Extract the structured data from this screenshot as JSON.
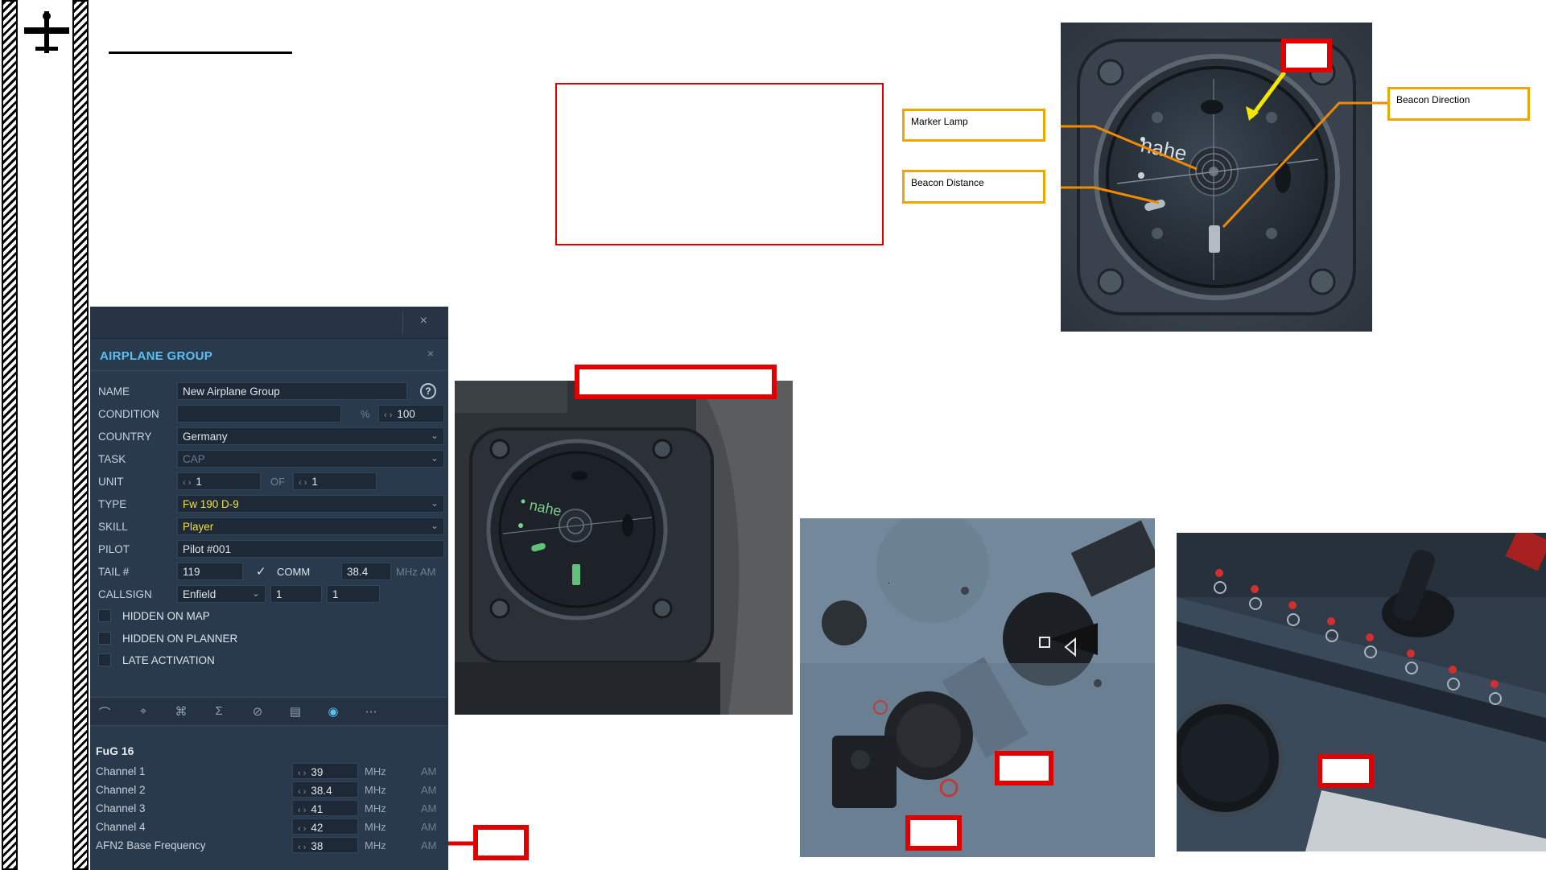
{
  "callouts": {
    "marker_lamp": "Marker Lamp",
    "beacon_distance": "Beacon Distance",
    "beacon_direction": "Beacon Direction"
  },
  "instrument": {
    "dial_text": "nahe"
  },
  "panel": {
    "title": "AIRPLANE GROUP",
    "close_glyph": "×",
    "help_glyph": "?",
    "fields": {
      "name": {
        "label": "NAME",
        "value": "New Airplane Group"
      },
      "condition": {
        "label": "CONDITION",
        "value": "100",
        "unit": "%"
      },
      "country": {
        "label": "COUNTRY",
        "value": "Germany"
      },
      "task": {
        "label": "TASK",
        "value": "CAP"
      },
      "unit": {
        "label": "UNIT",
        "value": "1",
        "of_label": "OF",
        "of_value": "1"
      },
      "type": {
        "label": "TYPE",
        "value": "Fw 190 D-9"
      },
      "skill": {
        "label": "SKILL",
        "value": "Player"
      },
      "pilot": {
        "label": "PILOT",
        "value": "Pilot #001"
      },
      "tail": {
        "label": "TAIL #",
        "value": "119",
        "comm_label": "COMM",
        "comm_value": "38.4",
        "mhz": "MHz",
        "am": "AM"
      },
      "callsign": {
        "label": "CALLSIGN",
        "value": "Enfield",
        "num1": "1",
        "num2": "1"
      }
    },
    "checkboxes": [
      "HIDDEN ON MAP",
      "HIDDEN ON PLANNER",
      "LATE ACTIVATION"
    ],
    "radio": {
      "title": "FuG 16",
      "unit": "MHz",
      "mode": "AM",
      "channels": [
        {
          "label": "Channel 1",
          "value": "39"
        },
        {
          "label": "Channel 2",
          "value": "38.4"
        },
        {
          "label": "Channel 3",
          "value": "41"
        },
        {
          "label": "Channel 4",
          "value": "42"
        },
        {
          "label": "AFN2 Base Frequency",
          "value": "38"
        }
      ]
    }
  },
  "colors": {
    "annotation_red": "#e00000",
    "callout_orange": "#f0a500",
    "arrow_yellow": "#f5e600",
    "panel_bg": "#2a3a4d",
    "title_blue": "#5bc0f0",
    "type_yellow": "#f0e040"
  }
}
